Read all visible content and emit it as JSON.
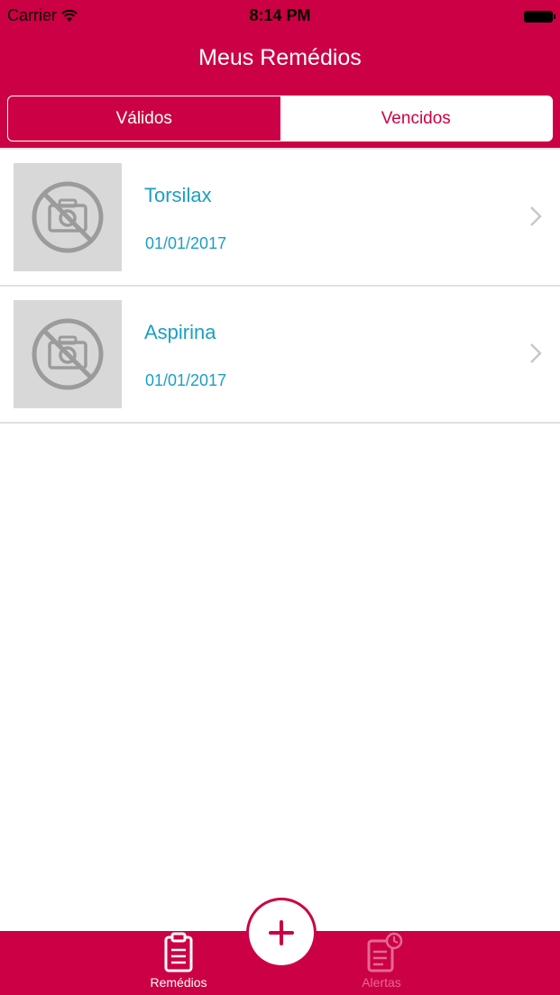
{
  "status_bar": {
    "carrier": "Carrier",
    "time": "8:14 PM"
  },
  "nav": {
    "title": "Meus Remédios"
  },
  "segments": [
    {
      "label": "Válidos",
      "selected": true
    },
    {
      "label": "Vencidos",
      "selected": false
    }
  ],
  "medicines": [
    {
      "name": "Torsilax",
      "date": "01/01/2017",
      "icon": "no-photo-icon"
    },
    {
      "name": "Aspirina",
      "date": "01/01/2017",
      "icon": "no-photo-icon"
    }
  ],
  "tabbar": {
    "remedios_label": "Remédios",
    "alertas_label": "Alertas",
    "add_icon": "plus-icon"
  },
  "colors": {
    "brand": "#cc0044",
    "link": "#1a9fc4",
    "placeholder_bg": "#d8d8d8",
    "inactive_tab": "#e26a92"
  }
}
